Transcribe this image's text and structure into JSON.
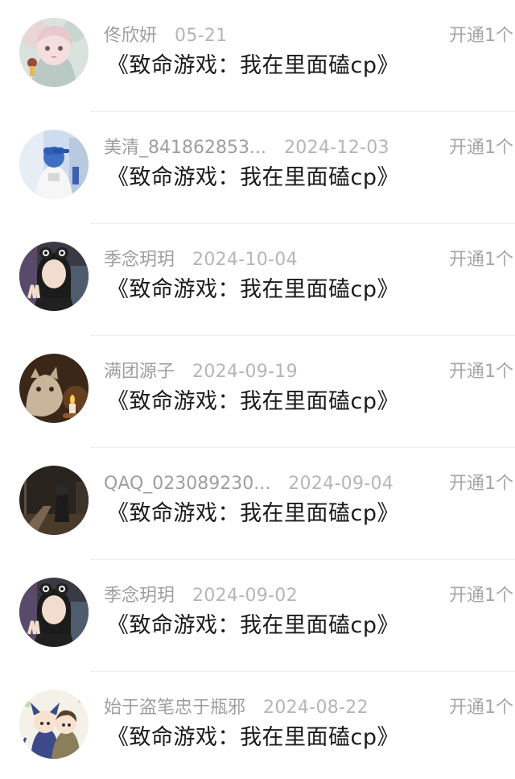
{
  "records": [
    {
      "name": "佟欣妍",
      "date": "05-21",
      "title": "《致命游戏：我在里面磕cp》",
      "action": "开通1个",
      "avatar": "avatar-anime-girl"
    },
    {
      "name": "美清_841862853...",
      "date": "2024-12-03",
      "title": "《致命游戏：我在里面磕cp》",
      "action": "开通1个",
      "avatar": "avatar-blue-cap-child"
    },
    {
      "name": "季念玥玥",
      "date": "2024-10-04",
      "title": "《致命游戏：我在里面磕cp》",
      "action": "开通1个",
      "avatar": "avatar-girl-peace-sign"
    },
    {
      "name": "满团源子",
      "date": "2024-09-19",
      "title": "《致命游戏：我在里面磕cp》",
      "action": "开通1个",
      "avatar": "avatar-cat-candle"
    },
    {
      "name": "QAQ_023089230...",
      "date": "2024-09-04",
      "title": "《致命游戏：我在里面磕cp》",
      "action": "开通1个",
      "avatar": "avatar-night-street"
    },
    {
      "name": "季念玥玥",
      "date": "2024-09-02",
      "title": "《致命游戏：我在里面磕cp》",
      "action": "开通1个",
      "avatar": "avatar-girl-peace-sign"
    },
    {
      "name": "始于盗笔忠于瓶邪",
      "date": "2024-08-22",
      "title": "《致命游戏：我在里面磕cp》",
      "action": "开通1个",
      "avatar": "avatar-cartoon-pair"
    }
  ]
}
